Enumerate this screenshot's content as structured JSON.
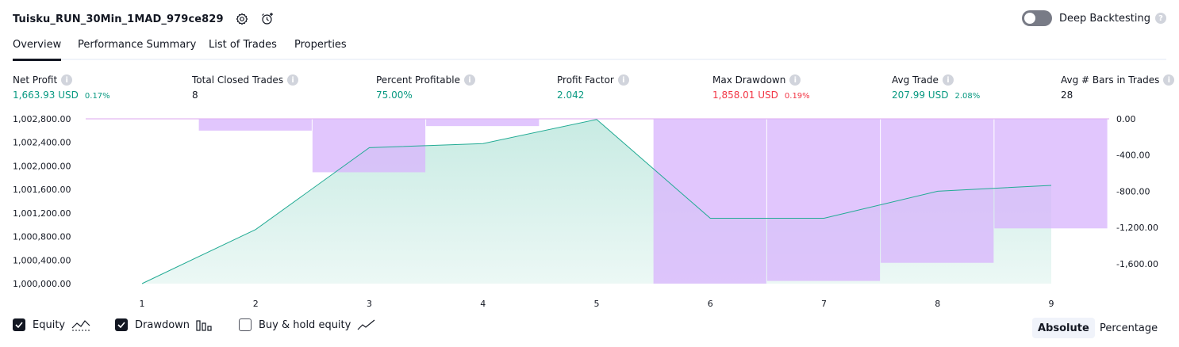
{
  "header": {
    "strategy_name": "Tuisku_RUN_30Min_1MAD_979ce829",
    "deep_backtesting_label": "Deep Backtesting",
    "deep_backtesting_on": false
  },
  "tabs": [
    "Overview",
    "Performance Summary",
    "List of Trades",
    "Properties"
  ],
  "metrics": {
    "net_profit": {
      "label": "Net Profit",
      "value": "1,663.93 USD",
      "pct": "0.17%"
    },
    "total_closed_trades": {
      "label": "Total Closed Trades",
      "value": "8"
    },
    "percent_profitable": {
      "label": "Percent Profitable",
      "value": "75.00%"
    },
    "profit_factor": {
      "label": "Profit Factor",
      "value": "2.042"
    },
    "max_drawdown": {
      "label": "Max Drawdown",
      "value": "1,858.01 USD",
      "pct": "0.19%"
    },
    "avg_trade": {
      "label": "Avg Trade",
      "value": "207.99 USD",
      "pct": "2.08%"
    },
    "avg_bars": {
      "label": "Avg # Bars in Trades",
      "value": "28"
    }
  },
  "chart_data": {
    "type": "line",
    "x": [
      1,
      2,
      3,
      4,
      5,
      6,
      7,
      8,
      9
    ],
    "series": [
      {
        "name": "Equity",
        "type": "area",
        "axis": "left",
        "values": [
          1000000,
          1000920,
          1002310,
          1002380,
          1002790,
          1001110,
          1001110,
          1001570,
          1001670
        ]
      },
      {
        "name": "Drawdown",
        "type": "bar",
        "axis": "right",
        "values": [
          0,
          -130,
          -590,
          -80,
          0,
          -1820,
          -1790,
          -1590,
          -1210
        ]
      }
    ],
    "y_left_ticks": [
      "1,002,800.00",
      "1,002,400.00",
      "1,002,000.00",
      "1,001,600.00",
      "1,001,200.00",
      "1,000,800.00",
      "1,000,400.00",
      "1,000,000.00"
    ],
    "y_left_range": [
      1000000,
      1002800
    ],
    "y_right_ticks": [
      "0.00",
      "-400.00",
      "-800.00",
      "-1,200.00",
      "-1,600.00"
    ],
    "y_right_range": [
      0,
      -1820
    ],
    "colors": {
      "equity_line": "#22ab94",
      "equity_fill": "#c8ebe3",
      "drawdown": "#d9b6fc",
      "drawdown_line": "#c96ee0"
    }
  },
  "legend": {
    "equity_label": "Equity",
    "equity_checked": true,
    "drawdown_label": "Drawdown",
    "drawdown_checked": true,
    "buyhold_label": "Buy & hold equity",
    "buyhold_checked": false
  },
  "view_toggle": {
    "absolute": "Absolute",
    "percentage": "Percentage",
    "active": "Absolute"
  }
}
